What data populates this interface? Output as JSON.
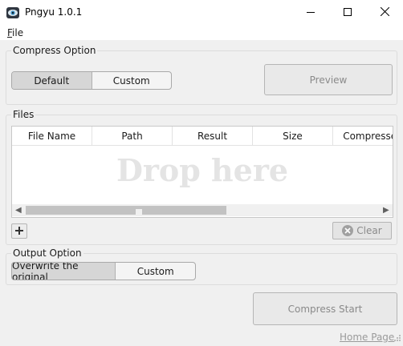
{
  "window": {
    "title": "Pngyu 1.0.1",
    "minimize_icon": "minimize-icon",
    "maximize_icon": "maximize-icon",
    "close_icon": "close-icon"
  },
  "menu": {
    "file_mnemonic": "F",
    "file_rest": "ile"
  },
  "compress_option": {
    "label": "Compress Option",
    "default_label": "Default",
    "custom_label": "Custom",
    "selected": "Default",
    "preview_label": "Preview"
  },
  "files": {
    "label": "Files",
    "columns": [
      "File Name",
      "Path",
      "Result",
      "Size",
      "Compressed"
    ],
    "rows": [],
    "drop_text": "Drop here",
    "add_icon": "plus-icon",
    "clear_label": "Clear",
    "clear_icon": "clear-x-icon"
  },
  "output_option": {
    "label": "Output Option",
    "overwrite_label": "Overwrite the original",
    "custom_label": "Custom",
    "selected": "Overwrite the original"
  },
  "compress_start_label": "Compress Start",
  "home_page_link": "Home Page"
}
